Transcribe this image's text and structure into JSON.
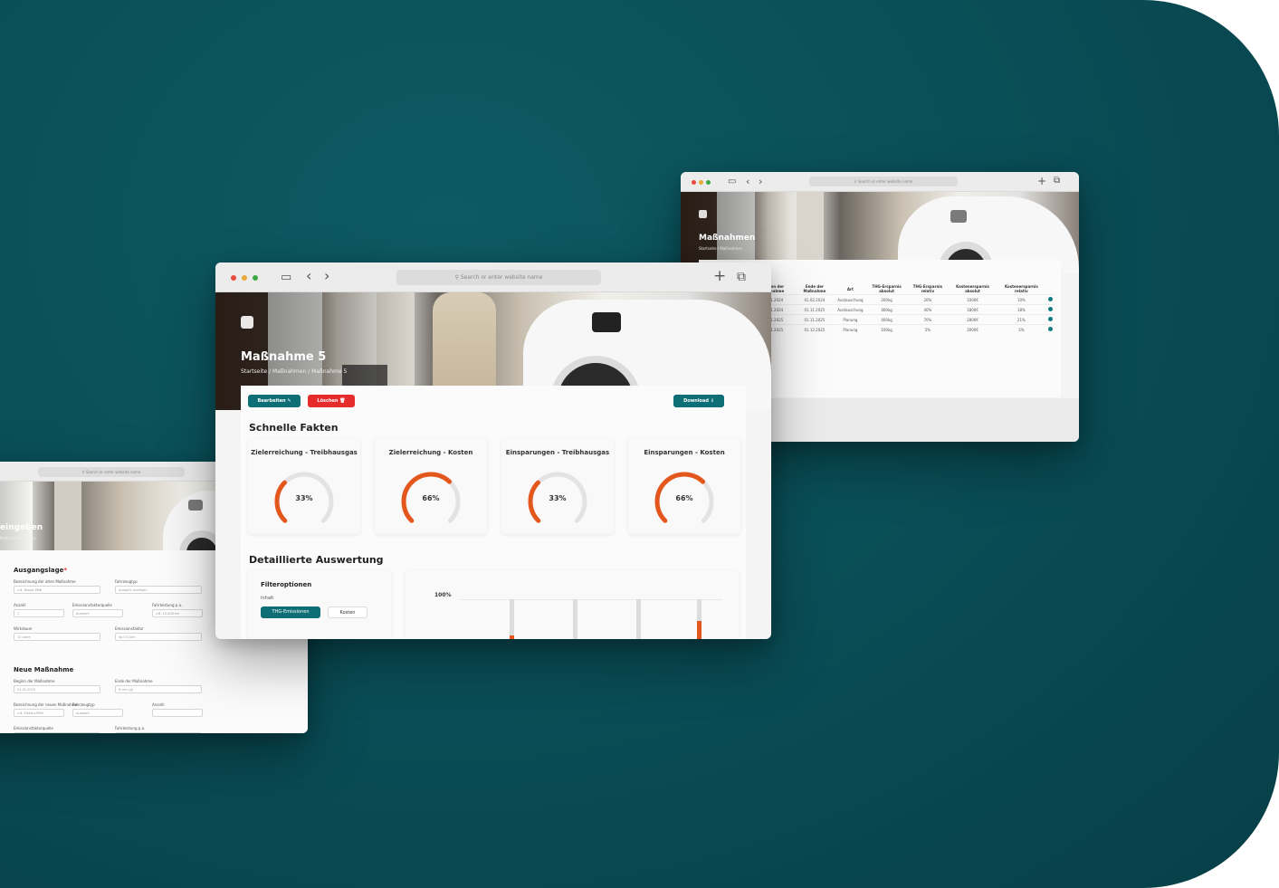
{
  "colors": {
    "background": "#0a4f58",
    "accent_teal": "#0e6e75",
    "delete_red": "#e52b2b",
    "gauge_orange": "#e4571c"
  },
  "main_window": {
    "url_placeholder": "Search or enter website name",
    "hero_title": "Maßnahme 5",
    "breadcrumb": "Startseite / Maßnahmen / Maßnahme 5",
    "edit_label": "Bearbeiten",
    "delete_label": "Löschen",
    "download_label": "Download",
    "quick_facts_title": "Schnelle Fakten",
    "quick_facts": [
      {
        "title": "Zielerreichung - Treibhausgas",
        "value": "33%",
        "fraction": 0.33
      },
      {
        "title": "Zielerreichung - Kosten",
        "value": "66%",
        "fraction": 0.66
      },
      {
        "title": "Einsparungen - Treibhausgas",
        "value": "33%",
        "fraction": 0.33
      },
      {
        "title": "Einsparungen - Kosten",
        "value": "66%",
        "fraction": 0.66
      }
    ],
    "detail_title": "Detaillierte Auswertung",
    "filter_title": "Filteroptionen",
    "filter_inhalt_label": "Inhalt",
    "filter_thg_label": "THG-Emissionen",
    "filter_kosten_label": "Kosten",
    "chart_top_label": "100%"
  },
  "back_window": {
    "url_placeholder": "Search or enter website name",
    "hero_title": "Maßnahmen",
    "hero_sub": "Startseite / Maßnahmen",
    "table": {
      "headers": [
        "Beginn der Maßnahme",
        "Ende der Maßnahme",
        "Art",
        "THG-Ersparnis absolut",
        "THG-Ersparnis relativ",
        "Kostenersparnis absolut",
        "Kostenersparnis relativ",
        ""
      ],
      "rows": [
        [
          "01.01.2024",
          "01.02.2024",
          "Austauschung",
          "200kg",
          "20%",
          "1000€",
          "10%",
          ""
        ],
        [
          "01.01.2024",
          "01.11.2025",
          "Austauschung",
          "400kg",
          "40%",
          "1800€",
          "18%",
          ""
        ],
        [
          "01.01.2025",
          "01.11.2025",
          "Planung",
          "400kg",
          "70%",
          "2800€",
          "21%",
          ""
        ],
        [
          "01.01.2025",
          "01.12.2025",
          "Planung",
          "100kg",
          "5%",
          "3000€",
          "3%",
          ""
        ]
      ]
    }
  },
  "left_window": {
    "url_placeholder": "Search or enter website name",
    "hero_title": "eingeben",
    "hero_sub": "Maßnahme anlegen",
    "ausgangslage_title": "Ausgangslage",
    "fields_ausgangslage": [
      {
        "label": "Bezeichnung der alten Maßnahme",
        "value": "z.B. Diesel-PKW"
      },
      {
        "label": "Fahrzeugtyp",
        "value": "Auswahl anzeigen"
      },
      {
        "label": "Anzahl",
        "value": "1"
      },
      {
        "label": "Emissionsfaktorquelle",
        "value": "Auswahl"
      },
      {
        "label": "Fahrleistung p.a.",
        "value": "z.B. 15.000 km"
      },
      {
        "label": "Wirkdauer",
        "value": "12 Jahre"
      },
      {
        "label": "Emissionsfaktor",
        "value": "kg CO₂/km"
      }
    ],
    "neue_title": "Neue Maßnahme",
    "fields_neue": [
      {
        "label": "Beginn der Maßnahme",
        "value": "01.01.2025"
      },
      {
        "label": "Ende der Maßnahme",
        "value": "tt.mm.jjjj"
      },
      {
        "label": "Bezeichnung der neuen Maßnahme",
        "value": "z.B. Elektro-PKW"
      },
      {
        "label": "Fahrzeugtyp",
        "value": "Auswahl"
      },
      {
        "label": "Anzahl",
        "value": ""
      },
      {
        "label": "Emissionsfaktorquelle",
        "value": ""
      },
      {
        "label": "Fahrleistung p.a.",
        "value": ""
      }
    ]
  }
}
